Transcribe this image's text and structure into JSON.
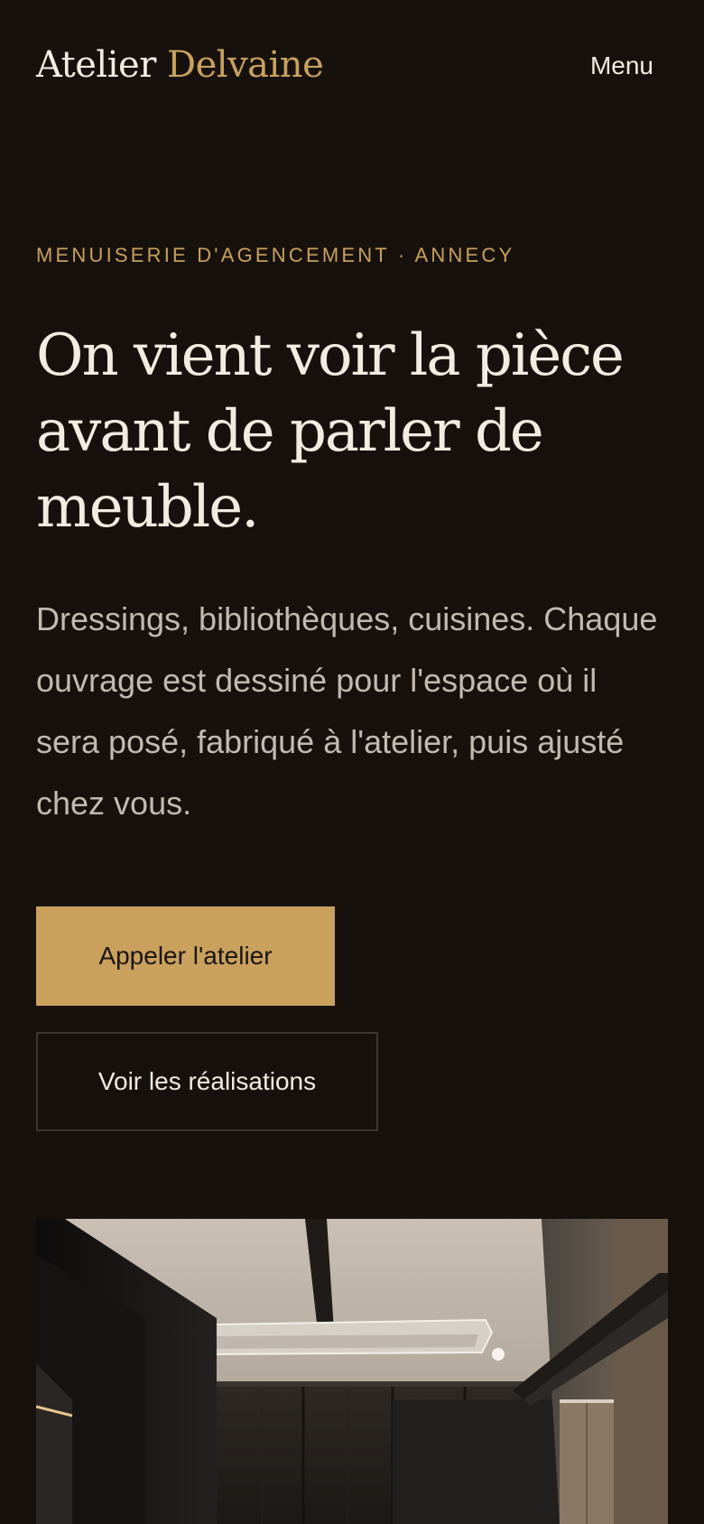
{
  "header": {
    "logo_primary": "Atelier",
    "logo_accent": "Delvaine",
    "menu_label": "Menu"
  },
  "hero": {
    "eyebrow": "MENUISERIE D'AGENCEMENT · ANNECY",
    "headline": "On vient voir la pièce avant de parler de meuble.",
    "lead": "Dressings, bibliothèques, cuisines. Chaque ouvrage est dessiné pour l'espace où il sera posé, fabriqué à l'atelier, puis ajusté chez vous.",
    "primary_cta": "Appeler l'atelier",
    "secondary_cta": "Voir les réalisations"
  },
  "colors": {
    "background": "#17110e",
    "accent": "#c9a15d",
    "text": "#f2ebe0",
    "muted_text": "#c2bab0"
  }
}
